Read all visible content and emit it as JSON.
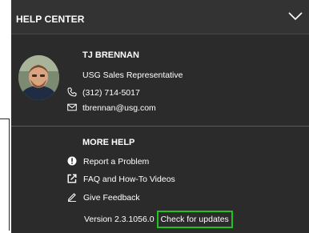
{
  "header": {
    "title": "HELP CENTER",
    "collapse_icon": "chevron-down-icon"
  },
  "contact": {
    "name": "TJ BRENNAN",
    "role": "USG Sales Representative",
    "phone": "(312) 714-5017",
    "email": "tbrennan@usg.com",
    "phone_icon": "phone-icon",
    "email_icon": "envelope-icon"
  },
  "more_help": {
    "title": "MORE HELP",
    "items": [
      {
        "label": "Report a Problem",
        "icon": "alert-circle-icon"
      },
      {
        "label": "FAQ and How-To Videos",
        "icon": "external-link-icon"
      },
      {
        "label": "Give Feedback",
        "icon": "pencil-icon"
      }
    ],
    "version": "Version 2.3.1056.0",
    "check_updates": "Check for updates"
  },
  "colors": {
    "panel_bg": "#2b2b2b",
    "header_bg": "#333333",
    "highlight": "#22c31e",
    "text": "#ffffff"
  }
}
